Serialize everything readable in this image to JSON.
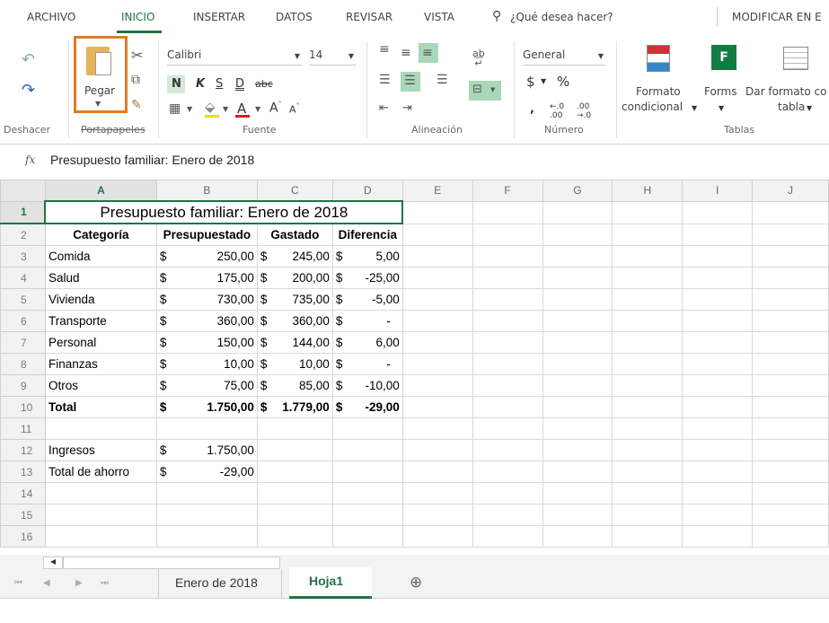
{
  "tabs": [
    "ARCHIVO",
    "INICIO",
    "INSERTAR",
    "DATOS",
    "REVISAR",
    "VISTA"
  ],
  "tell_me": "¿Qué desea hacer?",
  "modify_tab": "MODIFICAR EN E",
  "ribbon": {
    "paste_label": "Pegar",
    "font_name": "Calibri",
    "font_size": "14",
    "bold": "N",
    "italic": "K",
    "strike": "S",
    "underline_d": "D",
    "abc": "abc",
    "number_format": "General",
    "currency": "$",
    "percent": "%",
    "cond_format_label1": "Formato",
    "cond_format_label2": "condicional",
    "forms_label": "Forms",
    "table_format_label1": "Dar formato co",
    "table_format_label2": "tabla",
    "groups": {
      "undo": "Deshacer",
      "clipboard": "Portapapeles",
      "font": "Fuente",
      "align": "Alineación",
      "number": "Número",
      "tables": "Tablas"
    }
  },
  "formula_bar": {
    "fx": "fx",
    "content": "Presupuesto familiar: Enero de 2018"
  },
  "columns": [
    "A",
    "B",
    "C",
    "D",
    "E",
    "F",
    "G",
    "H",
    "I",
    "J"
  ],
  "rows": [
    {
      "n": "1",
      "title": "Presupuesto familiar: Enero de 2018"
    },
    {
      "n": "2",
      "a": "Categoría",
      "b": "Presupuestado",
      "c": "Gastado",
      "d": "Diferencia",
      "header": true
    },
    {
      "n": "3",
      "a": "Comida",
      "b": "250,00",
      "c": "245,00",
      "d": "5,00"
    },
    {
      "n": "4",
      "a": "Salud",
      "b": "175,00",
      "c": "200,00",
      "d": "-25,00"
    },
    {
      "n": "5",
      "a": "Vivienda",
      "b": "730,00",
      "c": "735,00",
      "d": "-5,00"
    },
    {
      "n": "6",
      "a": "Transporte",
      "b": "360,00",
      "c": "360,00",
      "d": "-"
    },
    {
      "n": "7",
      "a": "Personal",
      "b": "150,00",
      "c": "144,00",
      "d": "6,00"
    },
    {
      "n": "8",
      "a": "Finanzas",
      "b": "10,00",
      "c": "10,00",
      "d": "-"
    },
    {
      "n": "9",
      "a": "Otros",
      "b": "75,00",
      "c": "85,00",
      "d": "-10,00"
    },
    {
      "n": "10",
      "a": "Total",
      "b": "1.750,00",
      "c": "1.779,00",
      "d": "-29,00",
      "bold": true
    },
    {
      "n": "11"
    },
    {
      "n": "12",
      "a": "Ingresos",
      "b": "1.750,00"
    },
    {
      "n": "13",
      "a": "Total de ahorro",
      "b": "-29,00"
    },
    {
      "n": "14"
    },
    {
      "n": "15"
    },
    {
      "n": "16"
    }
  ],
  "currency_symbol": "$",
  "sheets": [
    "Enero de 2018",
    "Hoja1"
  ],
  "active_sheet": "Hoja1",
  "colors": {
    "accent": "#217346",
    "highlight": "#e07b24"
  }
}
